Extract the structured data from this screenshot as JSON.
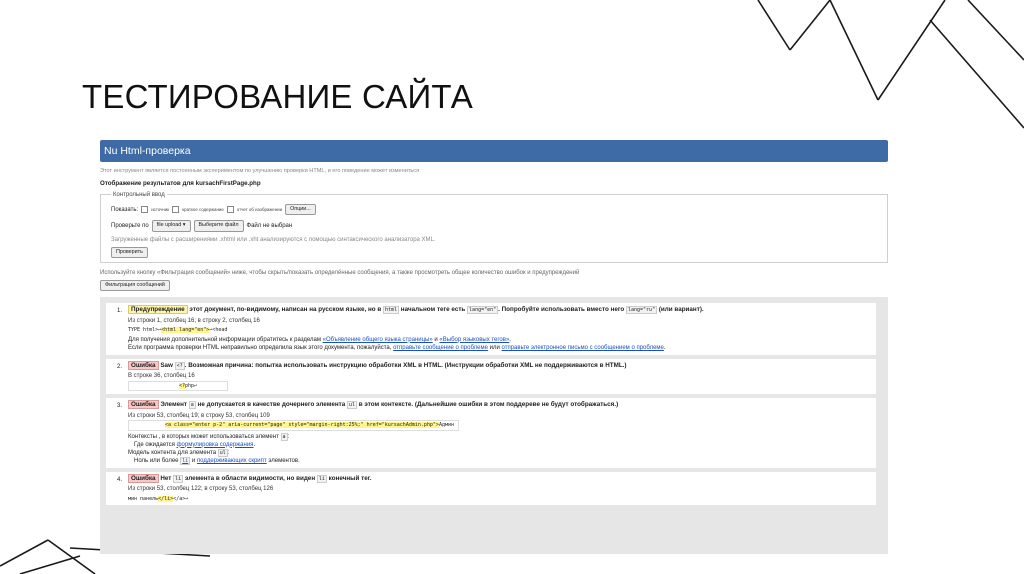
{
  "slide": {
    "title": "ТЕСТИРОВАНИЕ САЙТА"
  },
  "app": {
    "header": "Nu Html-проверка",
    "subtitle": "Этот инструмент является постоянным экспериментом по улучшению проверки HTML, и его поведение может измениться",
    "results_heading": "Отображение результатов для kursachFirstPage.php"
  },
  "control": {
    "legend": "Контрольный ввод",
    "show_label": "Показать:",
    "opt_source": "источник",
    "opt_outline": "краткое содержание",
    "opt_image_report": "отчет об изображении",
    "options_button": "Опции...",
    "check_by_label": "Проверьте по",
    "check_by_select": "file upload",
    "choose_file_button": "Выберите файл",
    "file_status": "Файл не выбран",
    "hint": "Загруженные файлы с расширениями .xhtml или .xht анализируются с помощью синтаксического анализатора XML.",
    "check_button": "Проверить"
  },
  "filter": {
    "note": "Используйте кнопку «Фильтрация сообщений» ниже, чтобы скрыть/показать определённые сообщения, а также просмотреть общее количество ошибок и предупреждений",
    "button": "Фильтрация сообщений"
  },
  "messages": [
    {
      "num": "1.",
      "badge": "Предупреждение",
      "t1": "этот документ, по-видимому, написан на русском языке, но в",
      "c1": "html",
      "t2": "начальном теге есть",
      "c2": "lang=\"en\"",
      "t3": ". Попробуйте использовать вместо него",
      "c3": "lang=\"ru\"",
      "t4": "(или вариант).",
      "loc": "Из строки 1, столбец 16; в строку 2, столбец 16",
      "ext_a": "TYPE html>↩",
      "ext_hl": "<html lang=\"en\">",
      "ext_b": "↩<head",
      "info1_a": "Для получения дополнительной информации обратитесь к разделам",
      "info1_link1": "«Объявление общего языка страницы»",
      "info1_mid": "и",
      "info1_link2": "«Выбор языковых тегов»",
      "info1_end": ".",
      "info2_a": "Если программа проверки HTML неправильно определила язык этого документа, пожалуйста,",
      "info2_link1": "отправьте сообщение о проблеме",
      "info2_mid": "или",
      "info2_link2": "отправьте электронное письмо с сообщением о проблеме",
      "info2_end": "."
    },
    {
      "num": "2.",
      "badge": "Ошибка",
      "t1": "Saw",
      "c1": "<?",
      "t2": ". Возможная причина: попытка использовать инструкцию обработки XML в HTML. (Инструкции обработки XML не поддерживаются в HTML.)",
      "loc": "В строке 36, столбец 16",
      "ext_hl": "<?",
      "ext_b": "php↩"
    },
    {
      "num": "3.",
      "badge": "Ошибка",
      "t1": "Элемент",
      "c1": "a",
      "t2": "не допускается в качестве дочернего элемента",
      "c2": "ul",
      "t3": "в этом контексте. (Дальнейшие ошибки в этом поддереве не будут отображаться.)",
      "loc": "Из строки 53, столбец 19; в строку 53, столбец 109",
      "ext_hl": "<a class=\"enter p-2\" aria-current=\"page\" style=\"margin-right:25%;\" href=\"kursachAdmin.php\">",
      "ext_b": "Админ",
      "ctx1": "Контексты , в которых может использоваться элемент",
      "ctx1_code": "a",
      "ctx1_end": ":",
      "ctx2_a": "Где ожидается",
      "ctx2_link": "формулировка содержания",
      "ctx2_end": ".",
      "model": "Модель контента для элемента",
      "model_code": "ul",
      "model_end": ":",
      "model2_a": "Ноль или более",
      "model2_code": "li",
      "model2_mid": "и",
      "model2_link": "поддерживающих скрипт",
      "model2_end": "элементов."
    },
    {
      "num": "4.",
      "badge": "Ошибка",
      "t1": "Нет",
      "c1": "li",
      "t2": "элемента в области видимости, но виден",
      "c2": "li",
      "t3": "конечный тег.",
      "loc": "Из строки 53, столбец 122; в строку 53, столбец 126",
      "ext_a": "мин панель",
      "ext_hl": "</li>",
      "ext_b": "</a>↩"
    }
  ]
}
